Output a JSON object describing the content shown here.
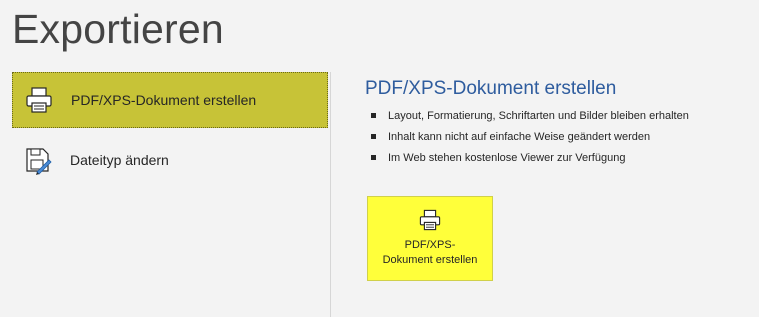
{
  "page": {
    "title": "Exportieren"
  },
  "sidebar": {
    "items": [
      {
        "label": "PDF/XPS-Dokument erstellen",
        "icon": "printer-document-icon",
        "selected": true
      },
      {
        "label": "Dateityp ändern",
        "icon": "change-file-type-icon",
        "selected": false
      }
    ]
  },
  "main": {
    "heading": "PDF/XPS-Dokument erstellen",
    "bullets": [
      "Layout, Formatierung, Schriftarten und Bilder bleiben erhalten",
      "Inhalt kann nicht auf einfache Weise geändert werden",
      "Im Web stehen kostenlose Viewer zur Verfügung"
    ],
    "create_button": {
      "label": "PDF/XPS-\nDokument erstellen",
      "icon": "printer-document-icon"
    }
  },
  "colors": {
    "selected_bg": "#c7c337",
    "button_bg": "#ffff3a",
    "heading": "#2e5c9e",
    "background": "#f3f3f3"
  }
}
